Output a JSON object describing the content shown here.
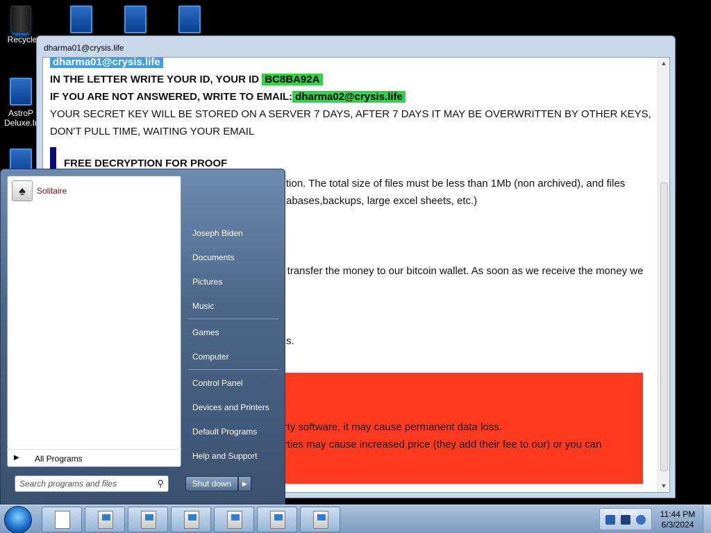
{
  "desktop": {
    "icons": [
      {
        "label": "Recycle",
        "name": "recycle-bin"
      },
      {
        "label": "",
        "name": "desktop-icon-2"
      },
      {
        "label": "",
        "name": "desktop-icon-3"
      },
      {
        "label": "",
        "name": "desktop-icon-4"
      },
      {
        "label": "AstroP Deluxe.Ir",
        "name": "astrop-deluxe"
      },
      {
        "label": "",
        "name": "desktop-icon-6"
      }
    ]
  },
  "note_window": {
    "title": "dharma01@crysis.life",
    "top_email": "dharma01@crysis.life",
    "line_id_prefix": "IN THE LETTER WRITE YOUR ID, YOUR ID",
    "id_value": "BC8BA92A",
    "line_email_prefix": "IF YOU ARE NOT ANSWERED, WRITE TO EMAIL:",
    "alt_email": "dharma02@crysis.life",
    "secret_key_text": "YOUR SECRET KEY WILL BE STORED ON A SERVER 7 DAYS, AFTER 7 DAYS IT MAY BE OVERWRITTEN BY OTHER KEYS, DON'T PULL TIME, WAITING YOUR EMAIL",
    "section_title": "FREE DECRYPTION FOR PROOF",
    "visible_fragment_1": "tion. The total size of files must be less than 1Mb (non archived), and files",
    "visible_fragment_2": "abases,backups, large excel sheets, etc.)",
    "visible_fragment_3": "y transfer the money to our bitcoin wallet. As soon as we receive the money we",
    "visible_fragment_4": "s.",
    "red_fragment_1": "party software, it may cause permanent data loss.",
    "red_fragment_2": "parties may cause increased price (they add their fee to our) or you can"
  },
  "start_menu": {
    "pinned_program": "Solitaire",
    "all_programs_label": "All Programs",
    "search_placeholder": "Search programs and files",
    "right_items": [
      "Joseph Biden",
      "Documents",
      "Pictures",
      "Music",
      "Games",
      "Computer",
      "Control Panel",
      "Devices and Printers",
      "Default Programs",
      "Help and Support"
    ],
    "shutdown_label": "Shut down"
  },
  "taskbar": {
    "clock_time": "11:44 PM",
    "clock_date": "6/3/2024",
    "tray_label": "Shut down"
  }
}
